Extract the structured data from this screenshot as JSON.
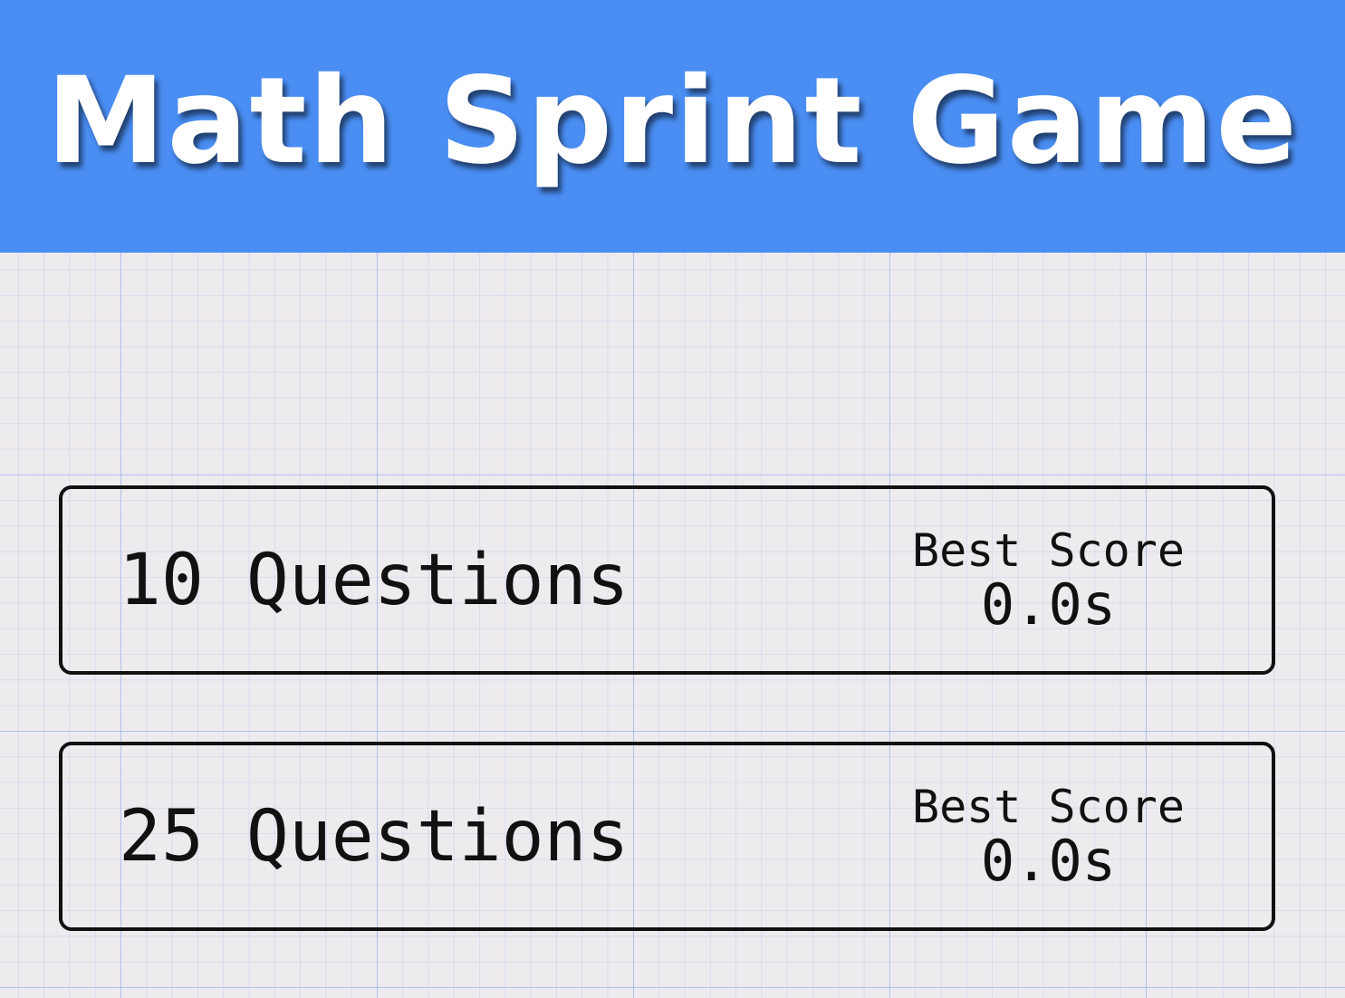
{
  "header": {
    "title": "Math Sprint Game"
  },
  "options": [
    {
      "label": "10 Questions",
      "best_score_label": "Best Score",
      "best_score_value": "0.0s"
    },
    {
      "label": "25 Questions",
      "best_score_label": "Best Score",
      "best_score_value": "0.0s"
    }
  ],
  "colors": {
    "header_bg": "#4a8ef4",
    "title_text": "#ffffff",
    "page_bg": "#eeebee",
    "grid_line": "#a0b4eb",
    "border": "#111111"
  }
}
